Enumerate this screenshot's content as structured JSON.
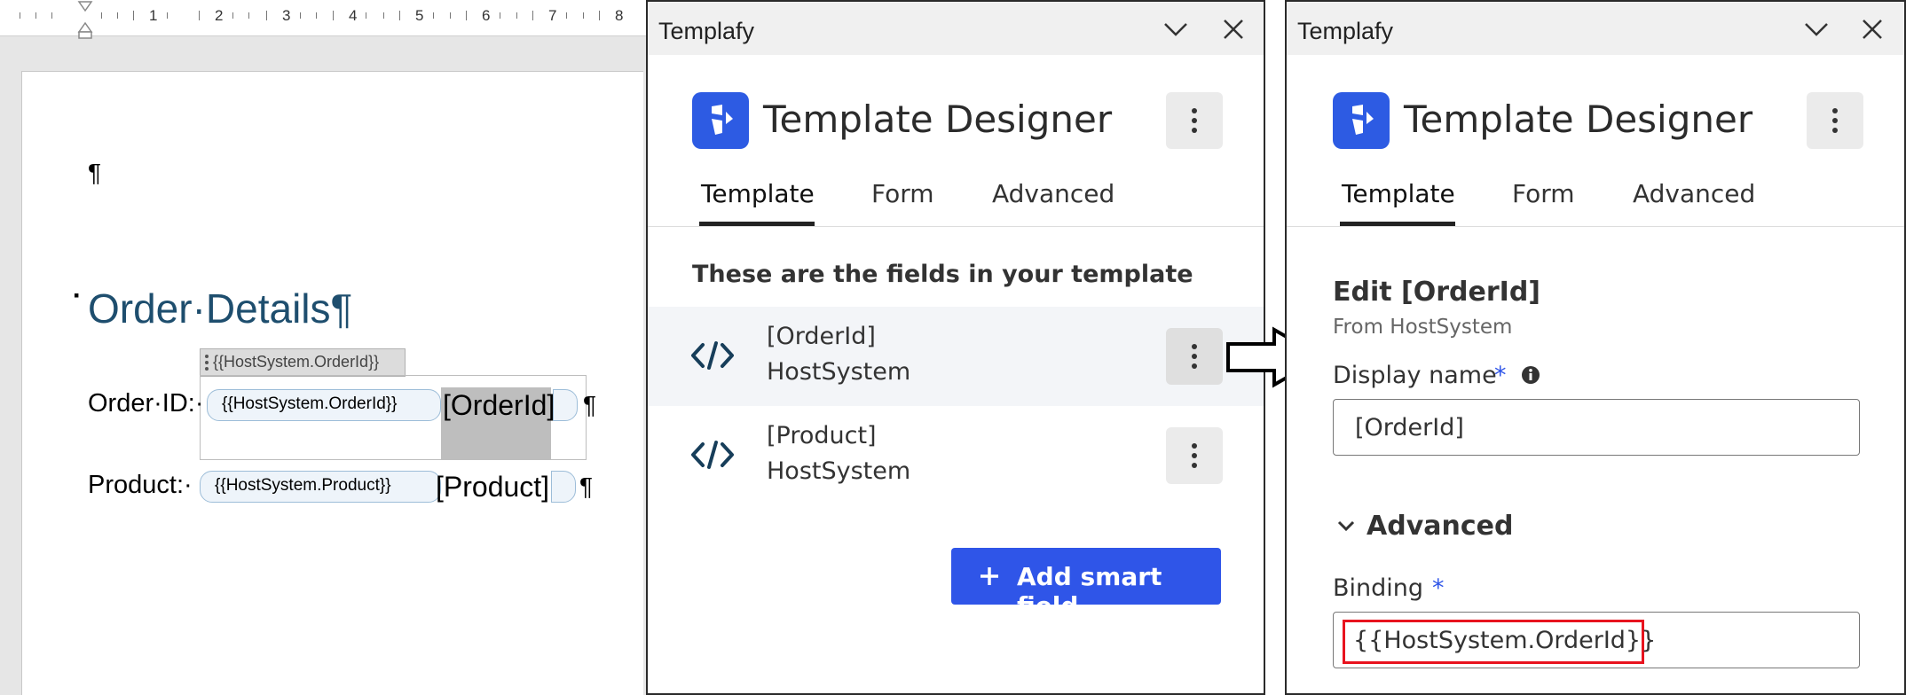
{
  "word": {
    "ruler_numbers": [
      "1",
      "2",
      "3",
      "4",
      "5",
      "6",
      "7",
      "8"
    ],
    "pilcrow": "¶",
    "heading": "Order·Details¶",
    "order_label": "Order·ID:·",
    "order_tag": "{{HostSystem.OrderId}}",
    "order_value": "[OrderId]",
    "order_tooltip": "{{HostSystem.OrderId}}",
    "product_label": "Product:·",
    "product_tag": "{{HostSystem.Product}}",
    "product_value": "[Product]"
  },
  "panel_left": {
    "window_title": "Templafy",
    "app_title": "Template Designer",
    "tabs": [
      "Template",
      "Form",
      "Advanced"
    ],
    "active_tab": "Template",
    "intro": "These are the fields in your template",
    "fields": [
      {
        "name": "[OrderId]",
        "source": "HostSystem",
        "selected": true
      },
      {
        "name": "[Product]",
        "source": "HostSystem",
        "selected": false
      }
    ],
    "add_button": "Add smart field"
  },
  "panel_right": {
    "window_title": "Templafy",
    "app_title": "Template Designer",
    "tabs": [
      "Template",
      "Form",
      "Advanced"
    ],
    "active_tab": "Template",
    "edit_title": "Edit [OrderId]",
    "edit_source": "From HostSystem",
    "display_name_label": "Display name",
    "required_marker": "*",
    "display_name_value": "[OrderId]",
    "advanced_label": "Advanced",
    "binding_label": "Binding",
    "binding_value": "{{HostSystem.OrderId}}"
  },
  "colors": {
    "accent": "#2f55e8",
    "heading": "#1e4e6e",
    "highlight": "#e8131e"
  }
}
